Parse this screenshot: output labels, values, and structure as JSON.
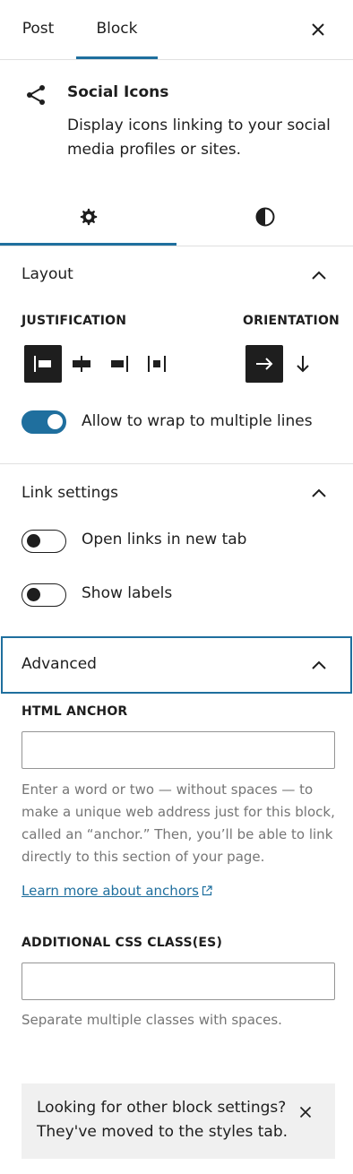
{
  "header": {
    "tabs": [
      {
        "label": "Post"
      },
      {
        "label": "Block"
      }
    ],
    "active_tab": "Block",
    "accent_color": "#1f6f9e"
  },
  "block_card": {
    "icon": "share-icon",
    "title": "Social Icons",
    "description": "Display icons linking to your social media profiles or sites."
  },
  "inspector_tabs": [
    {
      "icon": "gear-icon",
      "active": true
    },
    {
      "icon": "contrast-icon",
      "active": false
    }
  ],
  "layout": {
    "title": "Layout",
    "justification_label": "JUSTIFICATION",
    "orientation_label": "ORIENTATION",
    "justification_options": [
      {
        "icon": "justify-left-icon",
        "active": true
      },
      {
        "icon": "justify-center-icon",
        "active": false
      },
      {
        "icon": "justify-right-icon",
        "active": false
      },
      {
        "icon": "justify-space-between-icon",
        "active": false
      }
    ],
    "orientation_options": [
      {
        "icon": "arrow-right-icon",
        "active": true
      },
      {
        "icon": "arrow-down-icon",
        "active": false
      }
    ],
    "wrap_toggle": {
      "label": "Allow to wrap to multiple lines",
      "on": true
    }
  },
  "link_settings": {
    "title": "Link settings",
    "new_tab_toggle": {
      "label": "Open links in new tab",
      "on": false
    },
    "labels_toggle": {
      "label": "Show labels",
      "on": false
    }
  },
  "advanced": {
    "title": "Advanced",
    "anchor_label": "HTML ANCHOR",
    "anchor_value": "",
    "anchor_help": "Enter a word or two — without spaces — to make a unique web address just for this block, called an “anchor.” Then, you’ll be able to link directly to this section of your page.",
    "anchor_link": "Learn more about anchors",
    "css_label": "ADDITIONAL CSS CLASS(ES)",
    "css_value": "",
    "css_help": "Separate multiple classes with spaces."
  },
  "notice": {
    "text": "Looking for other block settings? They've moved to the styles tab."
  }
}
